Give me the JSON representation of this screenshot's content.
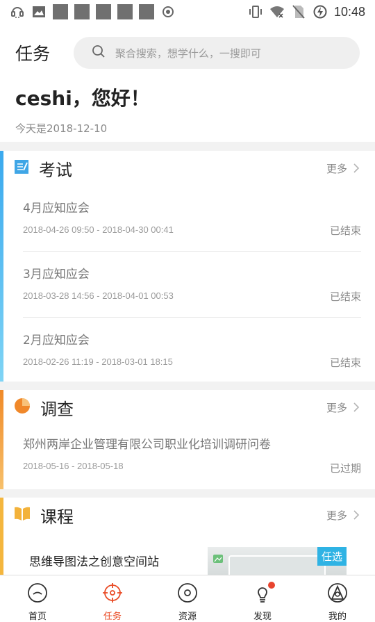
{
  "status_bar": {
    "time": "10:48"
  },
  "header": {
    "title": "任务",
    "search_placeholder": "聚合搜索，想学什么，一搜即可"
  },
  "greeting": {
    "title": "ceshi，您好！",
    "date": "今天是2018-12-10"
  },
  "exam": {
    "title": "考试",
    "more": "更多",
    "accent": "#3fb4ee",
    "items": [
      {
        "title": "4月应知应会",
        "date": "2018-04-26 09:50 - 2018-04-30 00:41",
        "status": "已结束"
      },
      {
        "title": "3月应知应会",
        "date": "2018-03-28 14:56 - 2018-04-01 00:53",
        "status": "已结束"
      },
      {
        "title": "2月应知应会",
        "date": "2018-02-26 11:19 - 2018-03-01 18:15",
        "status": "已结束"
      }
    ]
  },
  "survey": {
    "title": "调查",
    "more": "更多",
    "accent": "#f18a2a",
    "items": [
      {
        "title": "郑州两岸企业管理有限公司职业化培训调研问卷",
        "date": "2018-05-16 - 2018-05-18",
        "status": "已过期"
      }
    ]
  },
  "course": {
    "title": "课程",
    "more": "更多",
    "accent": "#f3b23a",
    "items": [
      {
        "title": "思维导图法之创意空间站",
        "tag": "任选"
      }
    ]
  },
  "tabbar": {
    "items": [
      {
        "label": "首页",
        "icon": "home-icon"
      },
      {
        "label": "任务",
        "icon": "target-icon"
      },
      {
        "label": "资源",
        "icon": "disc-icon"
      },
      {
        "label": "发现",
        "icon": "bulb-icon"
      },
      {
        "label": "我的",
        "icon": "profile-icon"
      }
    ],
    "active_color": "#e94a24"
  }
}
